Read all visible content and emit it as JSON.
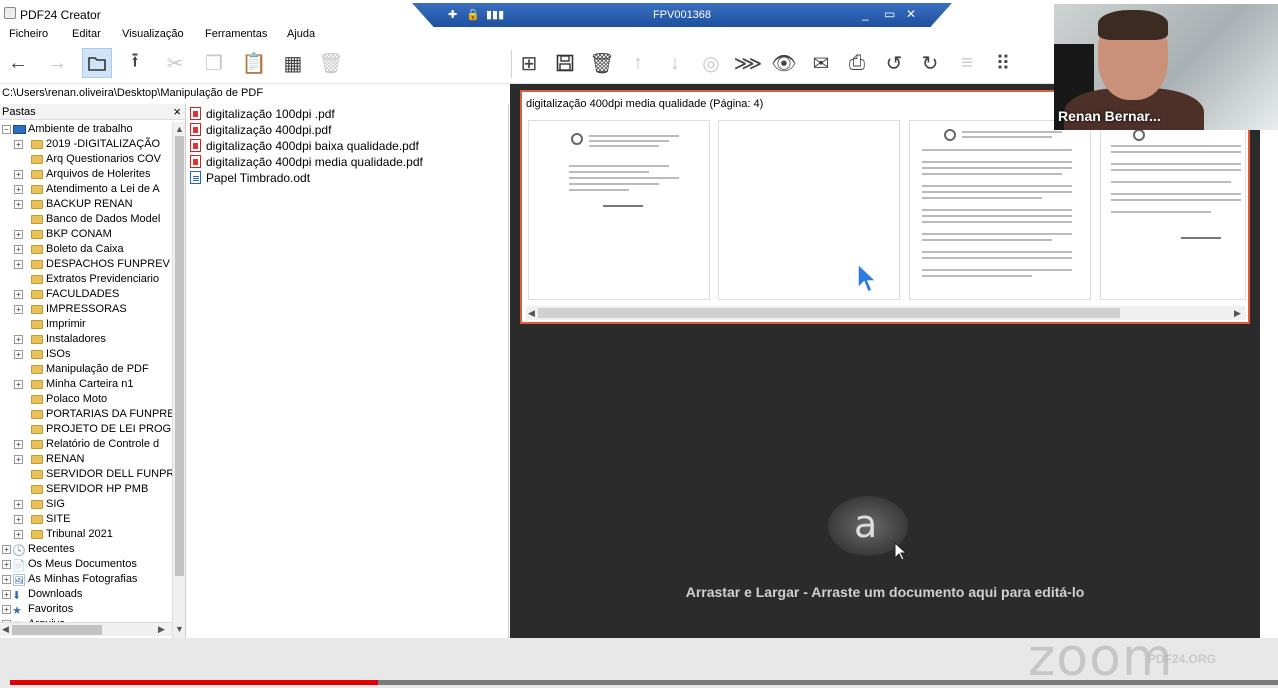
{
  "window": {
    "title": "PDF24 Creator"
  },
  "remote_bar": {
    "title": "FPV001368",
    "controls": [
      "_",
      "▭",
      "✕"
    ]
  },
  "menu": {
    "items": [
      "Ficheiro",
      "Editar",
      "Visualização",
      "Ferramentas",
      "Ajuda"
    ]
  },
  "path": "C:\\Users\\renan.oliveira\\Desktop\\Manipulação de PDF",
  "tree": {
    "header": "Pastas",
    "root": "Ambiente de trabalho",
    "items": [
      "2019 -DIGITALIZAÇÃO",
      "Arq Questionarios COV",
      "Arquivos de Holerites",
      "Atendimento a Lei de A",
      "BACKUP RENAN",
      "Banco de Dados Model",
      "BKP CONAM",
      "Boleto da Caixa",
      "DESPACHOS FUNPREV",
      "Extratos Previdenciario",
      "FACULDADES",
      "IMPRESSORAS",
      "Imprimir",
      "Instaladores",
      "ISOs",
      "Manipulação de PDF",
      "Minha Carteira n1",
      "Polaco Moto",
      "PORTARIAS DA FUNPRE",
      "PROJETO DE LEI PROG",
      "Relatório de Controle d",
      "RENAN",
      "SERVIDOR DELL FUNPR",
      "SERVIDOR HP PMB",
      "SIG",
      "SITE",
      "Tribunal 2021"
    ],
    "system": [
      "Recentes",
      "Os Meus Documentos",
      "As Minhas Fotografias",
      "Downloads",
      "Favoritos",
      "Arquivo"
    ]
  },
  "files": [
    {
      "name": "digitalização 100dpi .pdf",
      "type": "pdf"
    },
    {
      "name": "digitalização 400dpi.pdf",
      "type": "pdf"
    },
    {
      "name": "digitalização 400dpi baixa qualidade.pdf",
      "type": "pdf"
    },
    {
      "name": "digitalização 400dpi media qualidade.pdf",
      "type": "pdf"
    },
    {
      "name": "Papel Timbrado.odt",
      "type": "odt"
    }
  ],
  "document": {
    "title": "digitalização 400dpi media qualidade (Página: 4)",
    "page_count_visible": 4
  },
  "drop_zone": {
    "text": "Arrastar e Largar - Arraste um documento aqui para editá-lo",
    "icon_letter": "a"
  },
  "webcam": {
    "name": "Renan Bernar..."
  },
  "watermark": {
    "logo": "zoom",
    "sub": "PDF24.ORG"
  },
  "video_progress": 0.29
}
